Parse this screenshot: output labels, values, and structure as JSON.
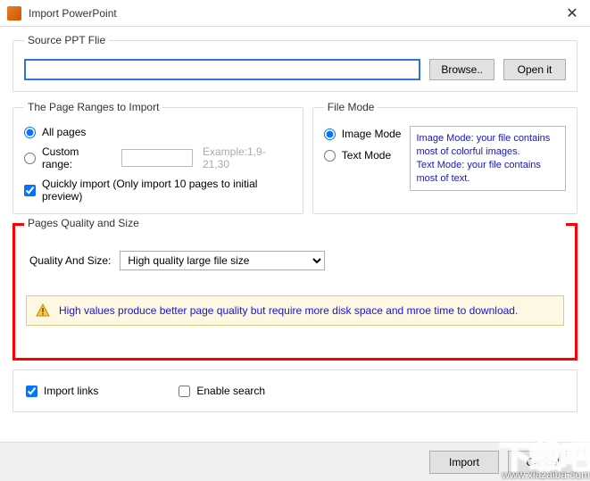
{
  "window": {
    "title": "Import PowerPoint",
    "close": "✕"
  },
  "source": {
    "legend": "Source PPT Flie",
    "value": "",
    "browse": "Browse..",
    "open": "Open it"
  },
  "ranges": {
    "legend": "The Page Ranges to Import",
    "all": "All pages",
    "custom": "Custom range:",
    "custom_value": "",
    "example": "Example:1,9-21,30",
    "quick": "Quickly import (Only import 10 pages to  initial  preview)"
  },
  "filemode": {
    "legend": "File Mode",
    "image": "Image Mode",
    "text": "Text Mode",
    "hint": "Image Mode: your file contains most of colorful images.\nText Mode: your file contains most of text."
  },
  "quality": {
    "legend": "Pages Quality and Size",
    "label": "Quality And Size:",
    "selected": "High quality large file size",
    "warning": "High values produce better page quality but require more disk space and mroe time to download."
  },
  "options": {
    "import_links": "Import links",
    "enable_search": "Enable search"
  },
  "footer": {
    "import": "Import",
    "cancel": "Cancel"
  },
  "watermark": {
    "cn": "下载吧",
    "url": "www.xiazaiba.com"
  }
}
